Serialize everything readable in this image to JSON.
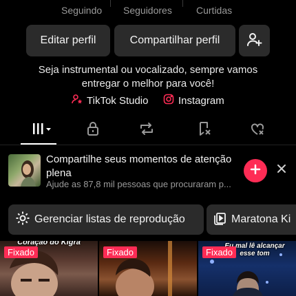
{
  "stats": {
    "following_label": "Seguindo",
    "followers_label": "Seguidores",
    "likes_label": "Curtidas"
  },
  "actions": {
    "edit_profile": "Editar perfil",
    "share_profile": "Compartilhar perfil",
    "add_friend_icon": "add-user-icon"
  },
  "bio": {
    "line1": "Seja instrumental ou vocalizado, sempre vamos",
    "line2": "entregar o melhor para você!"
  },
  "links": {
    "studio": "TikTok Studio",
    "instagram": "Instagram"
  },
  "tabs": [
    {
      "icon": "grid-icon",
      "selected": true
    },
    {
      "icon": "lock-icon",
      "selected": false
    },
    {
      "icon": "repost-icon",
      "selected": false
    },
    {
      "icon": "bookmark-icon",
      "selected": false
    },
    {
      "icon": "liked-icon",
      "selected": false
    }
  ],
  "banner": {
    "title": "Compartilhe seus momentos de atenção plena",
    "subtitle": "Ajude as 87,8 mil pessoas que procuraram p..."
  },
  "playlists": {
    "manage": "Gerenciar listas de reprodução",
    "marathon": "Maratona Ki"
  },
  "videos": [
    {
      "badge": "Fixado",
      "caption": "Coração do Kigra"
    },
    {
      "badge": "Fixado",
      "caption": ""
    },
    {
      "badge": "Fixado",
      "caption": "Eu mal lê alcançar esse tom"
    }
  ],
  "colors": {
    "accent": "#fe2c55",
    "button_bg": "#2b2b2b",
    "background": "#000000",
    "muted_text": "#9a9a9a"
  }
}
